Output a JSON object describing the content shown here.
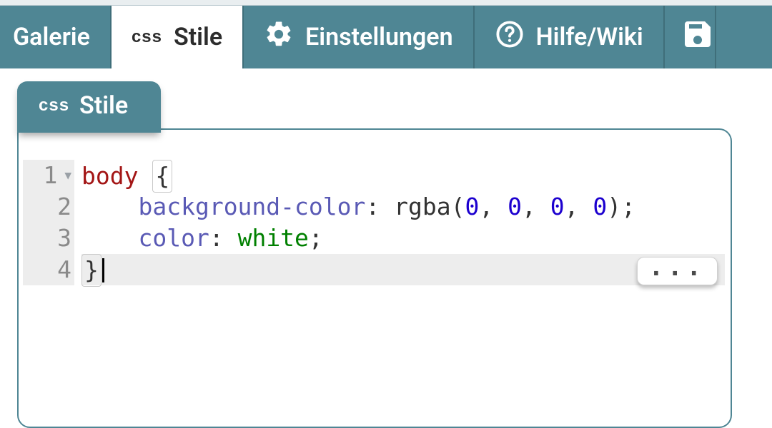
{
  "tabs": {
    "gallery": {
      "label": "Galerie"
    },
    "styles": {
      "label": "Stile",
      "badge": "css"
    },
    "settings": {
      "label": "Einstellungen"
    },
    "help": {
      "label": "Hilfe/Wiki"
    }
  },
  "panel": {
    "title": "Stile",
    "badge": "css"
  },
  "editor": {
    "lines": {
      "n1": "1",
      "n2": "2",
      "n3": "3",
      "n4": "4"
    },
    "code": {
      "l1_sel": "body",
      "l1_brace": "{",
      "l2_prop": "background-color",
      "l2_func": "rgba",
      "l2_n1": "0",
      "l2_n2": "0",
      "l2_n3": "0",
      "l2_n4": "0",
      "l3_prop": "color",
      "l3_val": "white",
      "l4_brace": "}"
    },
    "more": "..."
  },
  "colors": {
    "accent": "#4f8694"
  }
}
